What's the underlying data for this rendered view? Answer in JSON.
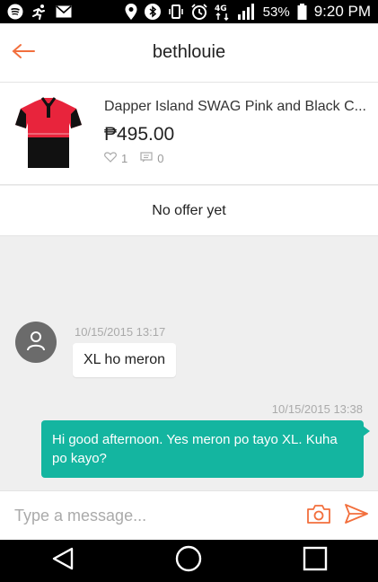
{
  "status_bar": {
    "battery": "53%",
    "time": "9:20 PM",
    "network": "4G",
    "icons": [
      "spotify-icon",
      "running-icon",
      "mail-icon",
      "location-icon",
      "bluetooth-icon",
      "vibrate-icon",
      "alarm-icon",
      "network-4g-icon",
      "signal-icon",
      "battery-icon"
    ]
  },
  "header": {
    "title": "bethlouie",
    "back_icon": "arrow-left-icon"
  },
  "product": {
    "name": "Dapper Island SWAG Pink and Black C...",
    "price": "₱495.00",
    "likes": "1",
    "comments": "0"
  },
  "offer": {
    "text": "No offer yet"
  },
  "messages": [
    {
      "direction": "incoming",
      "timestamp": "10/15/2015 13:17",
      "text": "XL ho meron"
    },
    {
      "direction": "outgoing",
      "timestamp": "10/15/2015 13:38",
      "text": "Hi good afternoon. Yes meron po tayo XL. Kuha po kayo?"
    }
  ],
  "composer": {
    "placeholder": "Type a message..."
  },
  "colors": {
    "accent": "#f26f3d",
    "bubble_out": "#14b5a0",
    "status_bar": "#000000",
    "nav_bar": "#000000"
  }
}
